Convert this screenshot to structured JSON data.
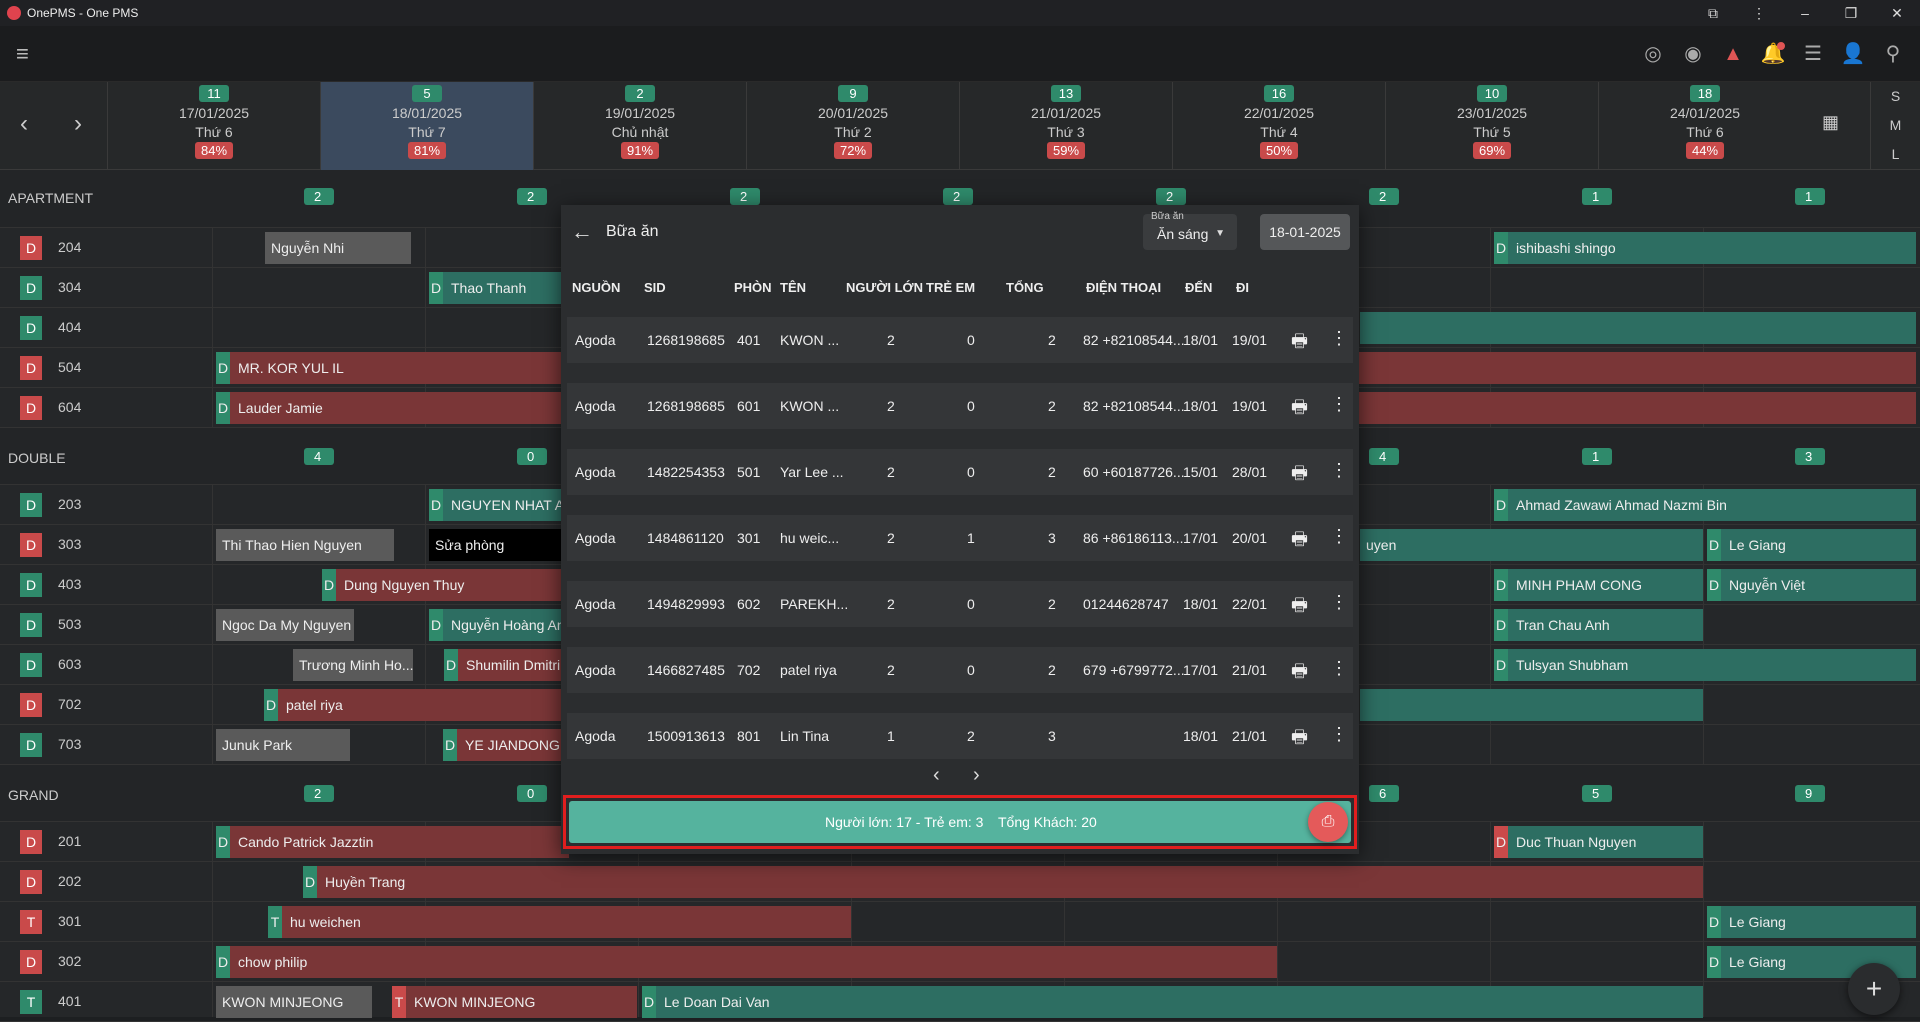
{
  "window": {
    "title": "OnePMS - One PMS"
  },
  "appbar": {
    "icons": [
      "menu-icon",
      "radar-icon",
      "eye-icon",
      "warning-icon",
      "bell-icon",
      "list-icon",
      "add-user-icon",
      "search-icon"
    ]
  },
  "dates": [
    {
      "count": "11",
      "date": "17/01/2025",
      "day": "Thứ 6",
      "occ": "84%"
    },
    {
      "count": "5",
      "date": "18/01/2025",
      "day": "Thứ 7",
      "occ": "81%"
    },
    {
      "count": "2",
      "date": "19/01/2025",
      "day": "Chủ nhật",
      "occ": "91%"
    },
    {
      "count": "9",
      "date": "20/01/2025",
      "day": "Thứ 2",
      "occ": "72%"
    },
    {
      "count": "13",
      "date": "21/01/2025",
      "day": "Thứ 3",
      "occ": "59%"
    },
    {
      "count": "16",
      "date": "22/01/2025",
      "day": "Thứ 4",
      "occ": "50%"
    },
    {
      "count": "10",
      "date": "23/01/2025",
      "day": "Thứ 5",
      "occ": "69%"
    },
    {
      "count": "18",
      "date": "24/01/2025",
      "day": "Thứ 6",
      "occ": "44%"
    }
  ],
  "view_modes": [
    "S",
    "M",
    "L"
  ],
  "categories": {
    "apartment": {
      "name": "APARTMENT",
      "counts": [
        "2",
        "2",
        "2",
        "2",
        "2",
        "2",
        "1",
        "1"
      ]
    },
    "double": {
      "name": "DOUBLE",
      "counts": [
        "4",
        "0",
        "",
        "",
        "",
        "4",
        "1",
        "3"
      ]
    },
    "grand": {
      "name": "GRAND",
      "counts": [
        "2",
        "0",
        "",
        "",
        "",
        "6",
        "5",
        "9"
      ]
    }
  },
  "rooms": [
    {
      "type": "D",
      "no": "204"
    },
    {
      "type": "D",
      "no": "304"
    },
    {
      "type": "D",
      "no": "404"
    },
    {
      "type": "D",
      "no": "504"
    },
    {
      "type": "D",
      "no": "604"
    },
    {
      "type": "D",
      "no": "203"
    },
    {
      "type": "D",
      "no": "303"
    },
    {
      "type": "D",
      "no": "403"
    },
    {
      "type": "D",
      "no": "503"
    },
    {
      "type": "D",
      "no": "603"
    },
    {
      "type": "D",
      "no": "702"
    },
    {
      "type": "D",
      "no": "703"
    },
    {
      "type": "D",
      "no": "201"
    },
    {
      "type": "D",
      "no": "202"
    },
    {
      "type": "T",
      "no": "301"
    },
    {
      "type": "D",
      "no": "302"
    },
    {
      "type": "T",
      "no": "401"
    }
  ],
  "bookings": [
    {
      "tag": "",
      "name": "Nguyễn Nhi"
    },
    {
      "tag": "D",
      "name": "ishibashi shingo"
    },
    {
      "tag": "D",
      "name": "Thao Thanh"
    },
    {
      "tag": "D",
      "name": "MR. KOR YUL IL"
    },
    {
      "tag": "D",
      "name": "Lauder Jamie"
    },
    {
      "tag": "D",
      "name": "NGUYEN NHAT AN"
    },
    {
      "tag": "D",
      "name": "Ahmad Zawawi Ahmad Nazmi Bin"
    },
    {
      "tag": "",
      "name": "Thi Thao Hien Nguyen"
    },
    {
      "tag": "",
      "name": "Sửa phòng"
    },
    {
      "tag": "",
      "name": "uyen"
    },
    {
      "tag": "D",
      "name": "Le Giang"
    },
    {
      "tag": "D",
      "name": "Dung Nguyen Thuy"
    },
    {
      "tag": "D",
      "name": "MINH PHAM CONG"
    },
    {
      "tag": "D",
      "name": "Nguyễn Việt"
    },
    {
      "tag": "",
      "name": "Ngoc Da My Nguyen"
    },
    {
      "tag": "D",
      "name": "Nguyễn Hoàng An"
    },
    {
      "tag": "D",
      "name": "Tran Chau Anh"
    },
    {
      "tag": "",
      "name": "Trương Minh Ho..."
    },
    {
      "tag": "D",
      "name": "Shumilin Dmitri"
    },
    {
      "tag": "D",
      "name": "Tulsyan Shubham"
    },
    {
      "tag": "D",
      "name": "patel riya"
    },
    {
      "tag": "",
      "name": "Junuk Park"
    },
    {
      "tag": "D",
      "name": "YE JIANDONG"
    },
    {
      "tag": "D",
      "name": "Cando Patrick Jazztin"
    },
    {
      "tag": "D",
      "name": "Duc Thuan Nguyen"
    },
    {
      "tag": "D",
      "name": "Huyền Trang"
    },
    {
      "tag": "T",
      "name": "hu weichen"
    },
    {
      "tag": "D",
      "name": "Le Giang"
    },
    {
      "tag": "D",
      "name": "chow philip"
    },
    {
      "tag": "D",
      "name": "Le Giang"
    },
    {
      "tag": "",
      "name": "KWON MINJEONG"
    },
    {
      "tag": "T",
      "name": "KWON MINJEONG"
    },
    {
      "tag": "D",
      "name": "Le Doan Dai Van"
    }
  ],
  "modal": {
    "title": "Bữa ăn",
    "select_label": "Bữa ăn",
    "select_value": "Ăn sáng",
    "date": "18-01-2025",
    "columns": [
      "NGUỒN",
      "SID",
      "PHÒN",
      "TÊN",
      "NGƯỜI LỚN",
      "TRẺ EM",
      "TỔNG",
      "ĐIỆN THOẠI",
      "ĐẾN",
      "ĐI"
    ],
    "rows": [
      {
        "src": "Agoda",
        "sid": "1268198685",
        "room": "401",
        "name": "KWON ...",
        "adults": "2",
        "kids": "0",
        "total": "2",
        "phone": "82 +82108544...",
        "arr": "18/01",
        "dep": "19/01"
      },
      {
        "src": "Agoda",
        "sid": "1268198685",
        "room": "601",
        "name": "KWON ...",
        "adults": "2",
        "kids": "0",
        "total": "2",
        "phone": "82 +82108544...",
        "arr": "18/01",
        "dep": "19/01"
      },
      {
        "src": "Agoda",
        "sid": "1482254353",
        "room": "501",
        "name": "Yar Lee ...",
        "adults": "2",
        "kids": "0",
        "total": "2",
        "phone": "60 +60187726...",
        "arr": "15/01",
        "dep": "28/01"
      },
      {
        "src": "Agoda",
        "sid": "1484861120",
        "room": "301",
        "name": "hu weic...",
        "adults": "2",
        "kids": "1",
        "total": "3",
        "phone": "86 +86186113...",
        "arr": "17/01",
        "dep": "20/01"
      },
      {
        "src": "Agoda",
        "sid": "1494829993",
        "room": "602",
        "name": "PAREKH...",
        "adults": "2",
        "kids": "0",
        "total": "2",
        "phone": "01244628747",
        "arr": "18/01",
        "dep": "22/01"
      },
      {
        "src": "Agoda",
        "sid": "1466827485",
        "room": "702",
        "name": "patel riya",
        "adults": "2",
        "kids": "0",
        "total": "2",
        "phone": "679 +6799772...",
        "arr": "17/01",
        "dep": "21/01"
      },
      {
        "src": "Agoda",
        "sid": "1500913613",
        "room": "801",
        "name": "Lin Tina",
        "adults": "1",
        "kids": "2",
        "total": "3",
        "phone": "",
        "arr": "18/01",
        "dep": "21/01"
      }
    ],
    "summary_left": "Người lớn: 17 - Trẻ em: 3",
    "summary_right": "Tổng Khách: 20"
  }
}
